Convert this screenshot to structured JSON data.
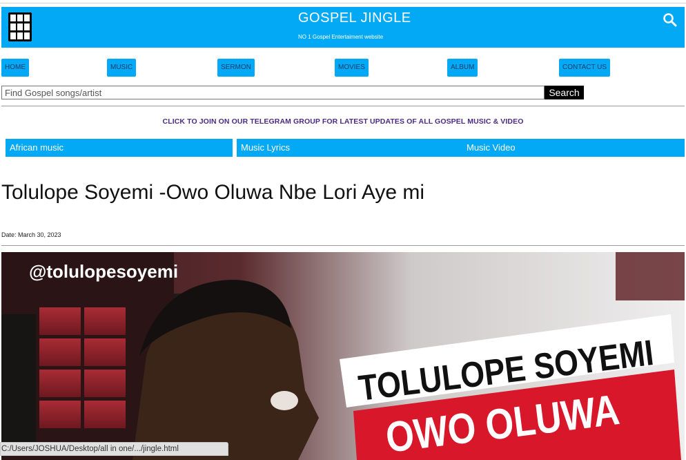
{
  "header": {
    "title": "GOSPEL JINGLE",
    "subtitle": "NO 1 Gospel Entertaiment website",
    "menu_icon": "grid-menu-icon",
    "search_icon": "search-icon",
    "brand_color": "#03a9f4"
  },
  "nav": {
    "items": [
      {
        "label": "HOME"
      },
      {
        "label": "MUSIC"
      },
      {
        "label": "SERMON"
      },
      {
        "label": "MOVIES"
      },
      {
        "label": "ALBUM"
      },
      {
        "label": "CONTACT US"
      }
    ]
  },
  "search": {
    "placeholder": "Find Gospel songs/artist",
    "button_label": "Search"
  },
  "telegram_banner": "CLICK TO JOIN ON OUR TELEGRAM GROUP FOR LATEST UPDATES OF ALL GOSPEL MUSIC & VIDEO",
  "categories": [
    {
      "label": "African music"
    },
    {
      "label": "Music Lyrics"
    },
    {
      "label": "Music Video"
    }
  ],
  "post": {
    "title": "Tolulope Soyemi -Owo Oluwa Nbe Lori Aye mi",
    "date": "Date: March 30, 2023",
    "image": {
      "handle": "@tolulopesoyemi",
      "line1": "TOLULOPE SOYEMI",
      "line2": "OWO OLUWA"
    }
  },
  "status_bar": {
    "url": "C:/Users/JOSHUA/Desktop/all in one/.../jingle.html"
  }
}
